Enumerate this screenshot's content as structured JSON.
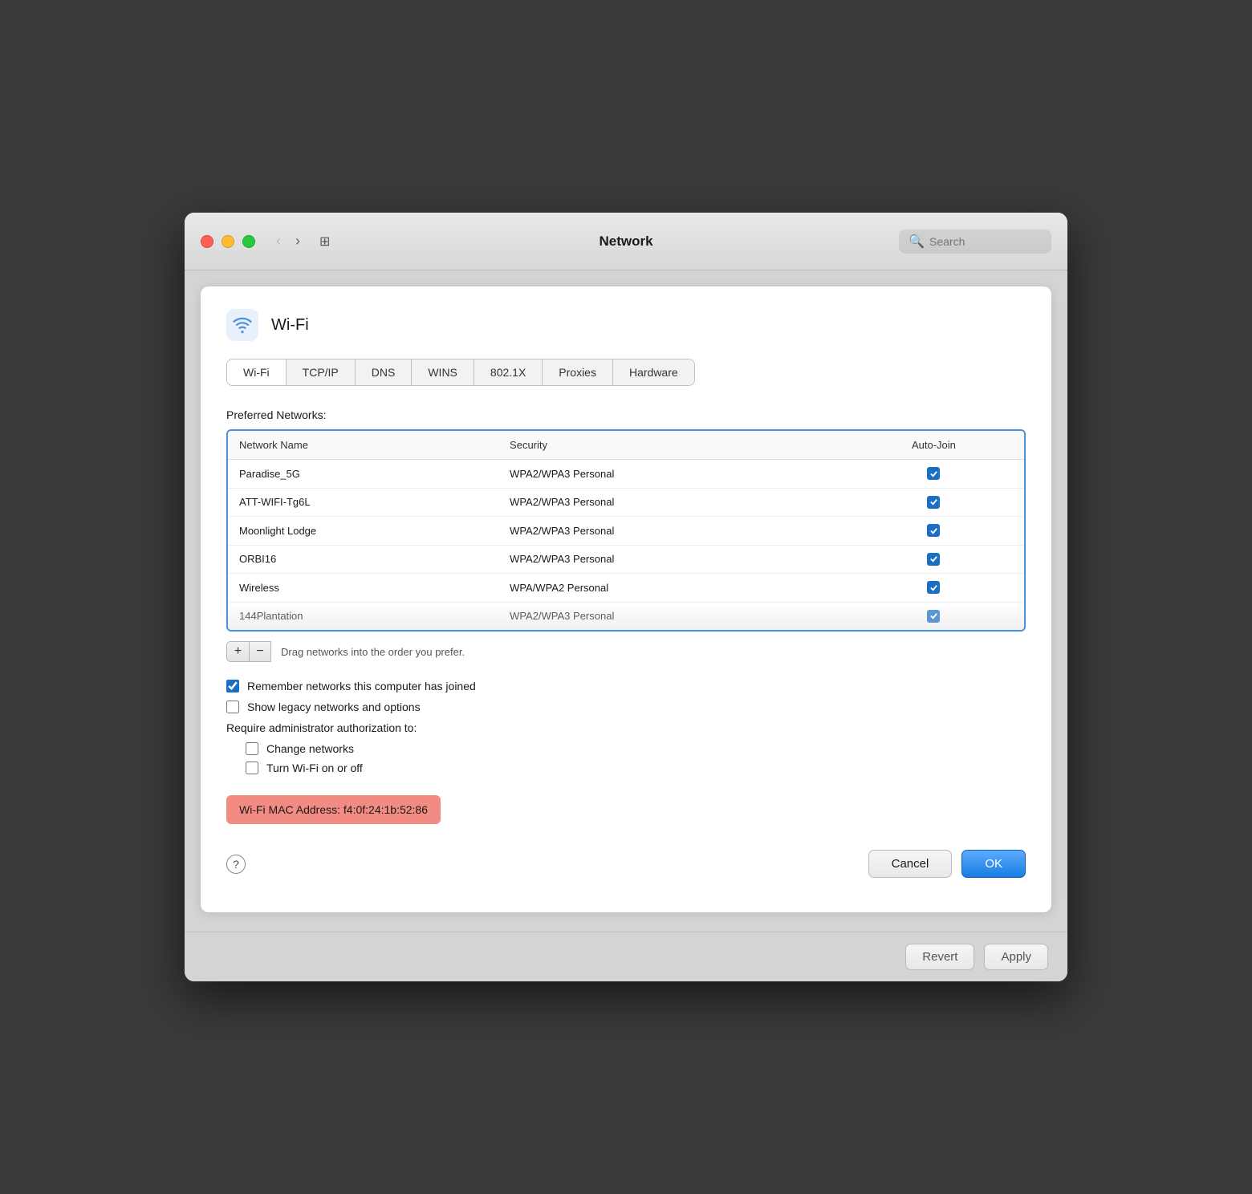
{
  "titleBar": {
    "title": "Network",
    "searchPlaceholder": "Search"
  },
  "wifiHeader": {
    "title": "Wi-Fi"
  },
  "tabs": [
    {
      "label": "Wi-Fi",
      "active": true
    },
    {
      "label": "TCP/IP",
      "active": false
    },
    {
      "label": "DNS",
      "active": false
    },
    {
      "label": "WINS",
      "active": false
    },
    {
      "label": "802.1X",
      "active": false
    },
    {
      "label": "Proxies",
      "active": false
    },
    {
      "label": "Hardware",
      "active": false
    }
  ],
  "preferredNetworks": {
    "label": "Preferred Networks:",
    "columns": {
      "networkName": "Network Name",
      "security": "Security",
      "autoJoin": "Auto-Join"
    },
    "rows": [
      {
        "name": "Paradise_5G",
        "security": "WPA2/WPA3 Personal",
        "autoJoin": true
      },
      {
        "name": "ATT-WIFI-Tg6L",
        "security": "WPA2/WPA3 Personal",
        "autoJoin": true
      },
      {
        "name": "Moonlight Lodge",
        "security": "WPA2/WPA3 Personal",
        "autoJoin": true
      },
      {
        "name": "ORBI16",
        "security": "WPA2/WPA3 Personal",
        "autoJoin": true
      },
      {
        "name": "Wireless",
        "security": "WPA/WPA2 Personal",
        "autoJoin": true
      },
      {
        "name": "144Plantation",
        "security": "WPA2/WPA3 Personal",
        "autoJoin": true,
        "partial": true
      }
    ]
  },
  "tableActions": {
    "addLabel": "+",
    "removeLabel": "−",
    "dragHint": "Drag networks into the order you prefer."
  },
  "checkboxes": {
    "rememberNetworks": {
      "label": "Remember networks this computer has joined",
      "checked": true
    },
    "showLegacy": {
      "label": "Show legacy networks and options",
      "checked": false
    }
  },
  "requireAuth": {
    "label": "Require administrator authorization to:",
    "options": [
      {
        "label": "Change networks",
        "checked": false
      },
      {
        "label": "Turn Wi-Fi on or off",
        "checked": false
      }
    ]
  },
  "macAddress": {
    "label": "Wi-Fi MAC Address:  f4:0f:24:1b:52:86"
  },
  "buttons": {
    "help": "?",
    "cancel": "Cancel",
    "ok": "OK",
    "revert": "Revert",
    "apply": "Apply"
  }
}
